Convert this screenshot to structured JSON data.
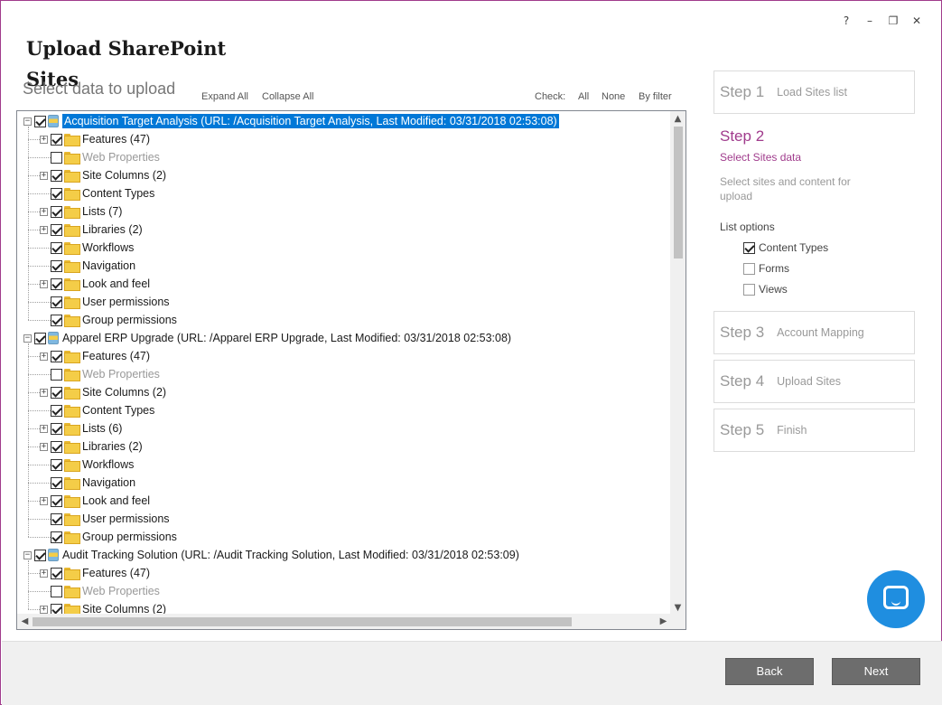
{
  "window": {
    "title": "Upload SharePoint Sites",
    "controls": {
      "help": "?",
      "minimize": "–",
      "restore": "❐",
      "close": "✕"
    }
  },
  "main": {
    "select_label": "Select data to upload",
    "expand_all": "Expand All",
    "collapse_all": "Collapse All",
    "check_label": "Check:",
    "check_all": "All",
    "check_none": "None",
    "check_by_filter": "By filter"
  },
  "tree": {
    "rows": [
      {
        "label": "Acquisition Target Analysis (URL: /Acquisition Target Analysis, Last Modified: 03/31/2018 02:53:08)",
        "level": 0,
        "expander": "−",
        "checked": true,
        "icon": "site-icon",
        "selected": true
      },
      {
        "label": "Features (47)",
        "level": 1,
        "expander": "+",
        "checked": true,
        "icon": "folder-icon"
      },
      {
        "label": "Web Properties",
        "level": 1,
        "expander": "",
        "checked": false,
        "icon": "folder-icon",
        "dim": true
      },
      {
        "label": "Site Columns (2)",
        "level": 1,
        "expander": "+",
        "checked": true,
        "icon": "folder-icon"
      },
      {
        "label": "Content Types",
        "level": 1,
        "expander": "",
        "checked": true,
        "icon": "folder-icon"
      },
      {
        "label": "Lists (7)",
        "level": 1,
        "expander": "+",
        "checked": true,
        "icon": "folder-icon"
      },
      {
        "label": "Libraries (2)",
        "level": 1,
        "expander": "+",
        "checked": true,
        "icon": "folder-icon"
      },
      {
        "label": "Workflows",
        "level": 1,
        "expander": "",
        "checked": true,
        "icon": "folder-icon"
      },
      {
        "label": "Navigation",
        "level": 1,
        "expander": "",
        "checked": true,
        "icon": "folder-icon"
      },
      {
        "label": "Look and feel",
        "level": 1,
        "expander": "+",
        "checked": true,
        "icon": "folder-icon"
      },
      {
        "label": "User permissions",
        "level": 1,
        "expander": "",
        "checked": true,
        "icon": "folder-icon"
      },
      {
        "label": "Group permissions",
        "level": 1,
        "expander": "",
        "checked": true,
        "icon": "folder-icon"
      },
      {
        "label": "Apparel ERP Upgrade (URL: /Apparel ERP Upgrade, Last Modified: 03/31/2018 02:53:08)",
        "level": 0,
        "expander": "−",
        "checked": true,
        "icon": "site-icon"
      },
      {
        "label": "Features (47)",
        "level": 1,
        "expander": "+",
        "checked": true,
        "icon": "folder-icon"
      },
      {
        "label": "Web Properties",
        "level": 1,
        "expander": "",
        "checked": false,
        "icon": "folder-icon",
        "dim": true
      },
      {
        "label": "Site Columns (2)",
        "level": 1,
        "expander": "+",
        "checked": true,
        "icon": "folder-icon"
      },
      {
        "label": "Content Types",
        "level": 1,
        "expander": "",
        "checked": true,
        "icon": "folder-icon"
      },
      {
        "label": "Lists (6)",
        "level": 1,
        "expander": "+",
        "checked": true,
        "icon": "folder-icon"
      },
      {
        "label": "Libraries (2)",
        "level": 1,
        "expander": "+",
        "checked": true,
        "icon": "folder-icon"
      },
      {
        "label": "Workflows",
        "level": 1,
        "expander": "",
        "checked": true,
        "icon": "folder-icon"
      },
      {
        "label": "Navigation",
        "level": 1,
        "expander": "",
        "checked": true,
        "icon": "folder-icon"
      },
      {
        "label": "Look and feel",
        "level": 1,
        "expander": "+",
        "checked": true,
        "icon": "folder-icon"
      },
      {
        "label": "User permissions",
        "level": 1,
        "expander": "",
        "checked": true,
        "icon": "folder-icon"
      },
      {
        "label": "Group permissions",
        "level": 1,
        "expander": "",
        "checked": true,
        "icon": "folder-icon"
      },
      {
        "label": "Audit Tracking Solution (URL: /Audit Tracking Solution, Last Modified: 03/31/2018 02:53:09)",
        "level": 0,
        "expander": "−",
        "checked": true,
        "icon": "site-icon"
      },
      {
        "label": "Features (47)",
        "level": 1,
        "expander": "+",
        "checked": true,
        "icon": "folder-icon"
      },
      {
        "label": "Web Properties",
        "level": 1,
        "expander": "",
        "checked": false,
        "icon": "folder-icon",
        "dim": true
      },
      {
        "label": "Site Columns (2)",
        "level": 1,
        "expander": "+",
        "checked": true,
        "icon": "folder-icon"
      }
    ]
  },
  "steps": {
    "step1": {
      "num": "Step 1",
      "name": "Load Sites list"
    },
    "step2": {
      "num": "Step 2",
      "name": "Select Sites data",
      "desc": "Select sites and content for upload"
    },
    "step3": {
      "num": "Step 3",
      "name": "Account Mapping"
    },
    "step4": {
      "num": "Step 4",
      "name": "Upload Sites"
    },
    "step5": {
      "num": "Step 5",
      "name": "Finish"
    }
  },
  "list_options": {
    "title": "List options",
    "items": [
      {
        "label": "Content Types",
        "checked": true
      },
      {
        "label": "Forms",
        "checked": false
      },
      {
        "label": "Views",
        "checked": false
      }
    ]
  },
  "footer": {
    "back": "Back",
    "next": "Next"
  },
  "colors": {
    "accent": "#a03b8c",
    "selection": "#0078d7",
    "chat": "#1f8ee0",
    "button": "#6d6d6d"
  }
}
